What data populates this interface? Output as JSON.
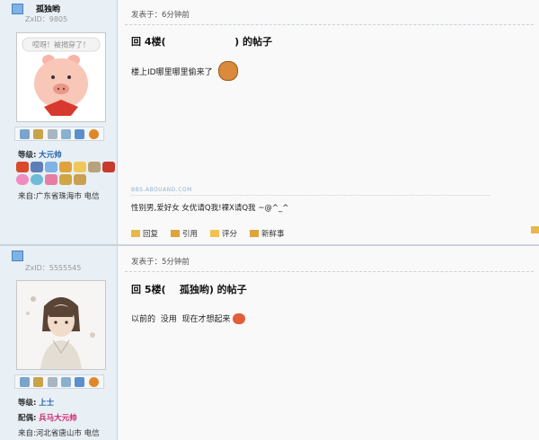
{
  "post1": {
    "username": "孤独哟",
    "uid": "ZxID：9805",
    "avatar_text": "哎呀！被揭穿了！",
    "tools": [
      "mail-icon",
      "user-icon",
      "search-icon",
      "profile-icon",
      "friends-icon",
      "qq-icon"
    ],
    "level_label": "等级:",
    "level_value": "大元帅",
    "from": "来自:广东省珠海市 电信",
    "posted": "发表于：6分钟前",
    "title": "回 4楼(                    ) 的帖子",
    "body": "楼上ID哪里哪里偷来了",
    "sig_logo": "BBS.ABOUAND.COM",
    "sig_text": "性别男,爱好女  女优请Q我!裸X请Q我 ~@^_^",
    "actions": [
      "回复",
      "引用",
      "评分",
      "新鲜事"
    ]
  },
  "post2": {
    "uid": "ZxID：5555545",
    "tools": [
      "mail-icon",
      "user-icon",
      "search-icon",
      "profile-icon",
      "friends-icon",
      "qq-icon"
    ],
    "level_label": "等级:",
    "level_value": "上士",
    "rank_label": "配偶:",
    "rank_value": "兵马大元帅",
    "from": "来自:河北省唐山市 电信",
    "posted": "发表于：5分钟前",
    "title": "回 5楼(    孤独哟) 的帖子",
    "body": "以前的  没用  现在才想起来"
  },
  "colors": {
    "sidebar": "#e8eff5",
    "level": "#1f5fa8",
    "rank": "#d0236f",
    "separator": "#c7d2dc"
  }
}
